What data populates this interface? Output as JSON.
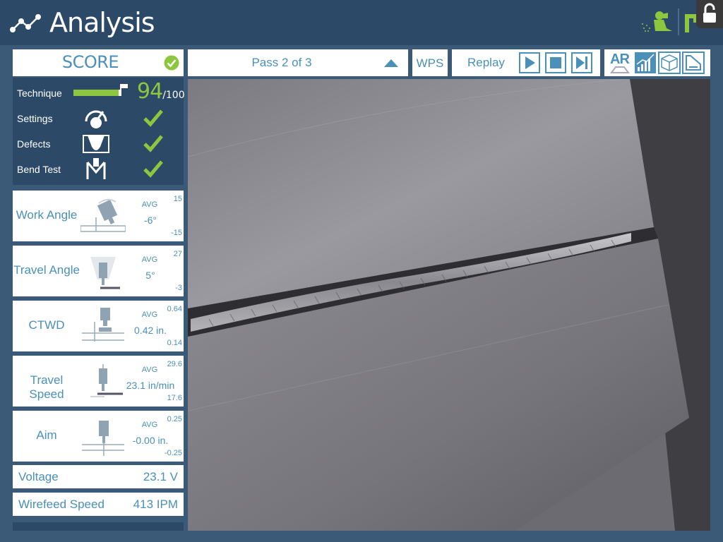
{
  "app": {
    "title": "Analysis"
  },
  "score": {
    "title": "SCORE",
    "rows": [
      {
        "label": "Technique",
        "value": "94",
        "max": "/100",
        "progress": 0.94
      },
      {
        "label": "Settings"
      },
      {
        "label": "Defects"
      },
      {
        "label": "Bend Test"
      }
    ]
  },
  "metrics": [
    {
      "label": "Work Angle",
      "avg_label": "AVG",
      "value": "-6°",
      "max": "15",
      "min": "-15"
    },
    {
      "label": "Travel Angle",
      "avg_label": "AVG",
      "value": "5°",
      "max": "27",
      "min": "-3"
    },
    {
      "label": "CTWD",
      "avg_label": "AVG",
      "value": "0.42 in.",
      "max": "0.64",
      "min": "0.14"
    },
    {
      "label": "Travel Speed",
      "avg_label": "AVG",
      "value": "23.1 in/min",
      "max": "29.6",
      "min": "17.6"
    },
    {
      "label": "Aim",
      "avg_label": "AVG",
      "value": "-0.00 in.",
      "max": "0.25",
      "min": "-0.25"
    }
  ],
  "voltage": {
    "label": "Voltage",
    "value": "23.1 V"
  },
  "wirefeed": {
    "label": "Wirefeed Speed",
    "value": "413 IPM"
  },
  "toolbar": {
    "pass_label": "Pass 2 of 3",
    "wps_label": "WPS",
    "replay_label": "Replay"
  },
  "views": {
    "ar_label": "AR"
  },
  "colors": {
    "accent": "#4a90b8",
    "green": "#8dc63f",
    "navy": "#2c4a68",
    "background": "#3a5a78"
  }
}
